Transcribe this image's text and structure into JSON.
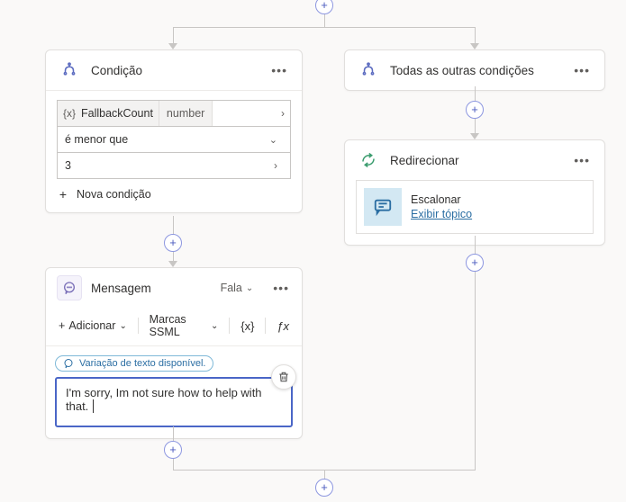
{
  "condition_card": {
    "title": "Condição",
    "variable_token": {
      "name": "FallbackCount",
      "type": "number"
    },
    "operator": "é menor que",
    "value": "3",
    "add_condition_label": "Nova condição"
  },
  "other_conditions_card": {
    "title": "Todas as outras condições"
  },
  "redirect_card": {
    "title": "Redirecionar",
    "step": {
      "title": "Escalonar",
      "link_label": "Exibir tópico"
    }
  },
  "message_card": {
    "title": "Mensagem",
    "mode_label": "Fala",
    "toolbar": {
      "add_label": "Adicionar",
      "ssml_label": "Marcas SSML",
      "curly_label": "{x}",
      "fx_label": "ƒx"
    },
    "variation_chip": "Variação de texto disponível.",
    "body_text": "I'm sorry, Im not sure how to help with that."
  },
  "icons": {
    "branch": "branch",
    "message": "message",
    "redirect": "redirect",
    "fx": "{x}"
  }
}
